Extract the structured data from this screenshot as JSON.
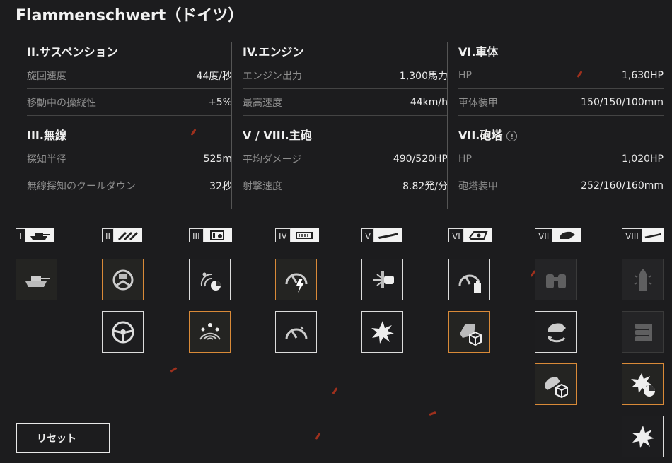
{
  "title": "Flammenschwert（ドイツ）",
  "columns": [
    {
      "sections": [
        {
          "title": "II.サスペンション",
          "warning": false,
          "rows": [
            {
              "label": "旋回速度",
              "value": "44度/秒"
            },
            {
              "label": "移動中の操縦性",
              "value": "+5%"
            }
          ]
        },
        {
          "title": "III.無線",
          "warning": false,
          "rows": [
            {
              "label": "探知半径",
              "value": "525m"
            },
            {
              "label": "無線探知のクールダウン",
              "value": "32秒"
            }
          ]
        }
      ]
    },
    {
      "sections": [
        {
          "title": "IV.エンジン",
          "warning": false,
          "rows": [
            {
              "label": "エンジン出力",
              "value": "1,300馬力"
            },
            {
              "label": "最高速度",
              "value": "44km/h"
            }
          ]
        },
        {
          "title": "V / VIII.主砲",
          "warning": false,
          "rows": [
            {
              "label": "平均ダメージ",
              "value": "490/520HP"
            },
            {
              "label": "射撃速度",
              "value": "8.82発/分"
            }
          ]
        }
      ]
    },
    {
      "sections": [
        {
          "title": "VI.車体",
          "warning": false,
          "rows": [
            {
              "label": "HP",
              "value": "1,630HP"
            },
            {
              "label": "車体装甲",
              "value": "150/150/100mm"
            }
          ]
        },
        {
          "title": "VII.砲塔",
          "warning": true,
          "rows": [
            {
              "label": "HP",
              "value": "1,020HP"
            },
            {
              "label": "砲塔装甲",
              "value": "252/160/160mm"
            }
          ]
        }
      ]
    }
  ],
  "tiers": [
    {
      "numeral": "I",
      "icon": "tank-icon"
    },
    {
      "numeral": "II",
      "icon": "suspension-icon"
    },
    {
      "numeral": "III",
      "icon": "radio-icon"
    },
    {
      "numeral": "IV",
      "icon": "engine-icon"
    },
    {
      "numeral": "V",
      "icon": "gun-icon"
    },
    {
      "numeral": "VI",
      "icon": "hull-icon"
    },
    {
      "numeral": "VII",
      "icon": "turret-icon"
    },
    {
      "numeral": "VIII",
      "icon": "gun-icon"
    }
  ],
  "reset_label": "リセット",
  "colors": {
    "selected_border": "#d98a38",
    "ember": "#c9371e",
    "background": "#1c1c1e"
  }
}
